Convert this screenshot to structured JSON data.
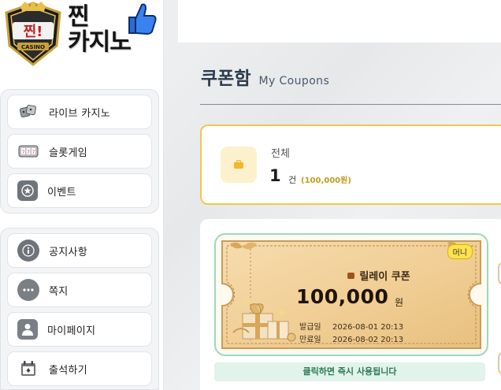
{
  "brand": {
    "logo_line1": "찐",
    "logo_line2": "카지노",
    "badge_text": "찐!",
    "badge_sub": "CASINO"
  },
  "sidebar": {
    "group1": [
      {
        "label": "라이브 카지노",
        "icon": "dice-icon"
      },
      {
        "label": "슬롯게임",
        "icon": "slot-machine-icon"
      },
      {
        "label": "이벤트",
        "icon": "star-icon"
      }
    ],
    "group2": [
      {
        "label": "공지사항",
        "icon": "info-icon"
      },
      {
        "label": "쪽지",
        "icon": "message-icon"
      },
      {
        "label": "마이페이지",
        "icon": "user-icon"
      },
      {
        "label": "출석하기",
        "icon": "calendar-icon"
      }
    ]
  },
  "page": {
    "title": "쿠폰함",
    "subtitle": "My Coupons"
  },
  "summary": {
    "label": "전체",
    "count": "1",
    "unit": "건",
    "amount": "(100,000원)"
  },
  "coupons": [
    {
      "badge": "머니",
      "name": "릴레이 쿠폰",
      "value": "100,000",
      "currency": "원",
      "issued_label": "발급일",
      "issued": "2026-08-01 20:13",
      "expires_label": "만료일",
      "expires": "2026-08-02 20:13",
      "action": "클릭하면 즉시 사용됩니다"
    }
  ],
  "colors": {
    "accent": "#f0c948",
    "mint": "#9bd8bf",
    "title": "#2c3b4e",
    "gold_text": "#c39a1a"
  }
}
